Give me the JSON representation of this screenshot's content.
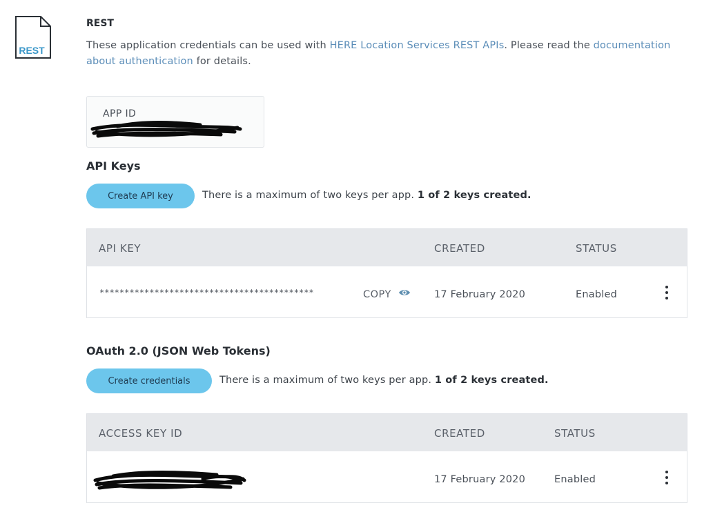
{
  "rest": {
    "icon_text": "REST",
    "title": "REST",
    "desc_before": "These application credentials can be used with ",
    "desc_link1": "HERE Location Services REST APIs",
    "desc_middle": ". Please read the ",
    "desc_link2": "documentation about authentication",
    "desc_after": " for details."
  },
  "app_id": {
    "label": "APP ID"
  },
  "api_keys": {
    "heading": "API Keys",
    "button": "Create API key",
    "note": "There is a maximum of two keys per app. ",
    "note_bold": "1 of 2 keys created.",
    "columns": [
      "API KEY",
      "CREATED",
      "STATUS"
    ],
    "rows": [
      {
        "key": "*******************************************",
        "copy": "COPY",
        "created": "17 February 2020",
        "status": "Enabled"
      }
    ]
  },
  "oauth": {
    "heading": "OAuth 2.0 (JSON Web Tokens)",
    "button": "Create credentials",
    "note": "There is a maximum of two keys per app. ",
    "note_bold": "1 of 2 keys created.",
    "columns": [
      "ACCESS KEY ID",
      "CREATED",
      "STATUS"
    ],
    "rows": [
      {
        "created": "17 February 2020",
        "status": "Enabled"
      }
    ]
  },
  "icons": {
    "file": "rest-file-icon",
    "eye": "eye-icon",
    "more": "more-vertical-icon"
  },
  "colors": {
    "accent_button": "#6cc6ec",
    "link": "#5b8db8",
    "rest_badge": "#3a97c9",
    "table_header": "#e6e8eb"
  }
}
